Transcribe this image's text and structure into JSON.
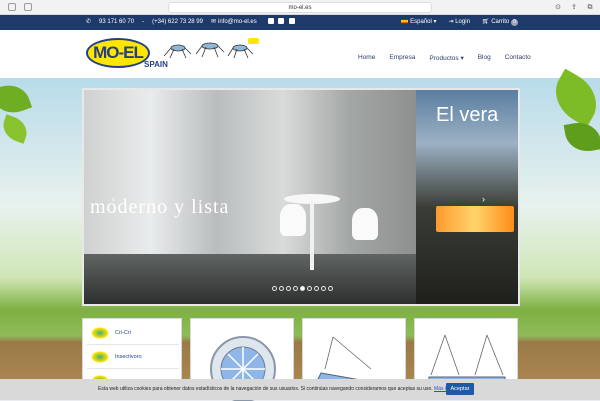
{
  "browser": {
    "url": "mo-el.es"
  },
  "topbar": {
    "phone1": "93 171 60 70",
    "phone2": "(+34) 622 73 28 99",
    "email": "info@mo-el.es",
    "language": "Español",
    "login": "Login",
    "cart": "Carrito",
    "cart_count": "0"
  },
  "header": {
    "logo_text": "MO-EL",
    "logo_sub": "SPAIN",
    "nav": [
      "Home",
      "Empresa",
      "Productos",
      "Blog",
      "Contacto"
    ]
  },
  "slider": {
    "caption_left": "moderno y lista",
    "caption_right": "El vera",
    "dots_total": 9,
    "active_dot": 4
  },
  "sidebar": {
    "items": [
      "Cri-Cri",
      "Insectivoro",
      ""
    ]
  },
  "cookie": {
    "message": "Esta web utiliza cookies para obtener datos estadísticos de la navegación de sus usuarios. Si continúas navegando consideramos que aceptas su uso.",
    "link": "Más información",
    "accept": "Aceptar"
  },
  "colors": {
    "brand_navy": "#1e3a6b",
    "brand_yellow": "#ffe600",
    "accept_blue": "#1e5aa6"
  }
}
